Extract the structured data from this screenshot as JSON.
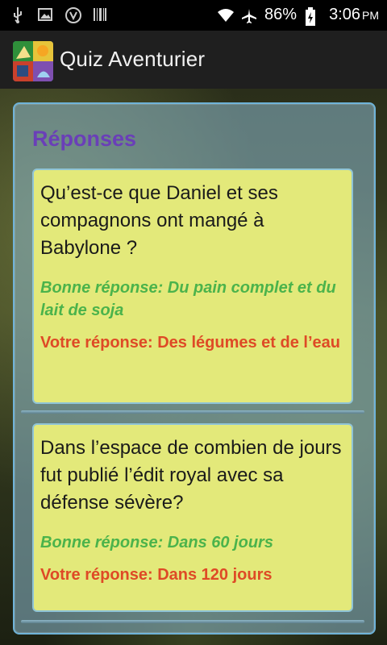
{
  "status_bar": {
    "battery_percent": "86%",
    "time": "3:06",
    "ampm": "PM",
    "icons": [
      "usb-icon",
      "image-icon",
      "vcast-icon",
      "barcode-icon",
      "wifi-icon",
      "airplane-icon",
      "battery-icon"
    ]
  },
  "app_bar": {
    "title": "Quiz Aventurier",
    "logo_icon": "quiz-logo-icon"
  },
  "panel": {
    "title": "Réponses",
    "title_color": "#6a3fb8",
    "correct_color": "#4bb34b",
    "wrong_color": "#de4a26",
    "card_color": "#e3e97a",
    "items": [
      {
        "question": "Qu’est-ce que Daniel et ses compagnons ont mangé à Babylone ?",
        "correct": "Bonne réponse: Du pain complet et du lait de soja",
        "yours": "Votre réponse: Des légumes et de l’eau"
      },
      {
        "question": "Dans l’espace de combien de jours fut publié l’édit royal avec sa défense sévère?",
        "correct": "Bonne réponse: Dans 60 jours",
        "yours": "Votre réponse: Dans 120 jours"
      }
    ]
  }
}
